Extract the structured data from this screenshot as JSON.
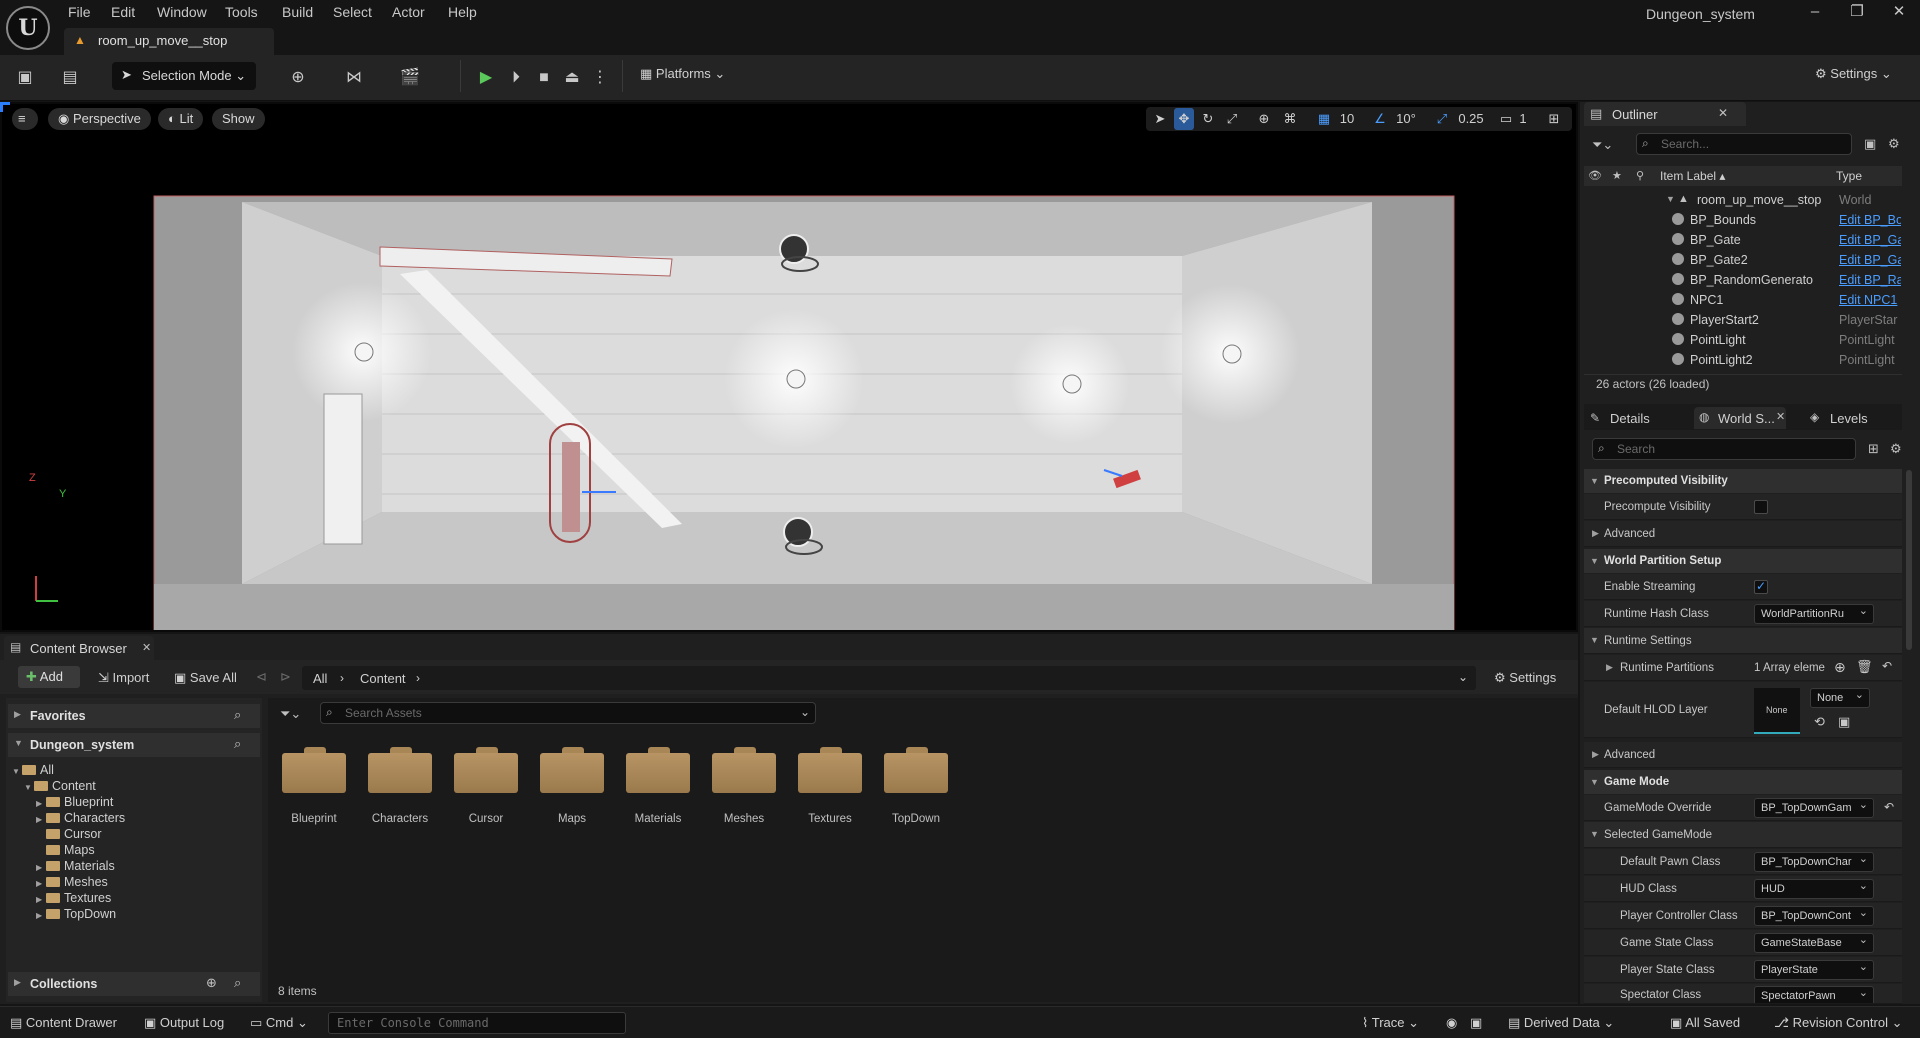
{
  "window": {
    "project_name": "Dungeon_system",
    "level_tab": "room_up_move__stop"
  },
  "menu": [
    "File",
    "Edit",
    "Window",
    "Tools",
    "Build",
    "Select",
    "Actor",
    "Help"
  ],
  "toolbar": {
    "selection_mode": "Selection Mode",
    "platforms": "Platforms",
    "settings": "Settings"
  },
  "viewport": {
    "perspective": "Perspective",
    "lit": "Lit",
    "show": "Show",
    "grid_size": "10",
    "rotation_snap": "10°",
    "scale_snap": "0.25",
    "camera_speed": "1",
    "axis_y": "Y",
    "axis_z": "Z"
  },
  "outliner": {
    "title": "Outliner",
    "search_placeholder": "Search...",
    "col_label": "Item Label",
    "col_type": "Type",
    "rows": [
      {
        "label": "room_up_move__stop",
        "type": "World",
        "link": false
      },
      {
        "label": "BP_Bounds",
        "type": "Edit BP_Bo",
        "link": true
      },
      {
        "label": "BP_Gate",
        "type": "Edit BP_Ga",
        "link": true
      },
      {
        "label": "BP_Gate2",
        "type": "Edit BP_Ga",
        "link": true
      },
      {
        "label": "BP_RandomGenerato",
        "type": "Edit BP_Ra",
        "link": true
      },
      {
        "label": "NPC1",
        "type": "Edit NPC1",
        "link": true
      },
      {
        "label": "PlayerStart2",
        "type": "PlayerStar",
        "link": false
      },
      {
        "label": "PointLight",
        "type": "PointLight",
        "link": false
      },
      {
        "label": "PointLight2",
        "type": "PointLight",
        "link": false
      }
    ],
    "actor_count": "26 actors (26 loaded)"
  },
  "details": {
    "tabs": [
      "Details",
      "World S...",
      "Levels"
    ],
    "search_placeholder": "Search",
    "sections": {
      "precomputed_visibility": "Precomputed Visibility",
      "precompute_visibility_label": "Precompute Visibility",
      "advanced": "Advanced",
      "world_partition_setup": "World Partition Setup",
      "enable_streaming_label": "Enable Streaming",
      "runtime_hash_class_label": "Runtime Hash Class",
      "runtime_hash_class_value": "WorldPartitionRu",
      "runtime_settings": "Runtime Settings",
      "runtime_partitions_label": "Runtime Partitions",
      "runtime_partitions_value": "1 Array eleme",
      "default_hlod_layer_label": "Default HLOD Layer",
      "hlod_thumb": "None",
      "hlod_value": "None",
      "advanced2": "Advanced",
      "game_mode": "Game Mode",
      "gamemode_override_label": "GameMode Override",
      "gamemode_override_value": "BP_TopDownGam",
      "selected_gamemode": "Selected GameMode",
      "default_pawn_label": "Default Pawn Class",
      "default_pawn_value": "BP_TopDownChar",
      "hud_label": "HUD Class",
      "hud_value": "HUD",
      "player_controller_label": "Player Controller Class",
      "player_controller_value": "BP_TopDownCont",
      "game_state_label": "Game State Class",
      "game_state_value": "GameStateBase",
      "player_state_label": "Player State Class",
      "player_state_value": "PlayerState",
      "spectator_label": "Spectator Class",
      "spectator_value": "SpectatorPawn"
    }
  },
  "content_browser": {
    "tab": "Content Browser",
    "add": "Add",
    "import": "Import",
    "save_all": "Save All",
    "path": [
      "All",
      "Content"
    ],
    "settings": "Settings",
    "favorites": "Favorites",
    "project": "Dungeon_system",
    "tree": [
      "All",
      "Content",
      "Blueprint",
      "Characters",
      "Cursor",
      "Maps",
      "Materials",
      "Meshes",
      "Textures",
      "TopDown"
    ],
    "collections": "Collections",
    "search_placeholder": "Search Assets",
    "folders": [
      "Blueprint",
      "Characters",
      "Cursor",
      "Maps",
      "Materials",
      "Meshes",
      "Textures",
      "TopDown"
    ],
    "item_count": "8 items"
  },
  "statusbar": {
    "content_drawer": "Content Drawer",
    "output_log": "Output Log",
    "cmd": "Cmd",
    "console_placeholder": "Enter Console Command",
    "trace": "Trace",
    "derived_data": "Derived Data",
    "all_saved": "All Saved",
    "revision_control": "Revision Control"
  }
}
